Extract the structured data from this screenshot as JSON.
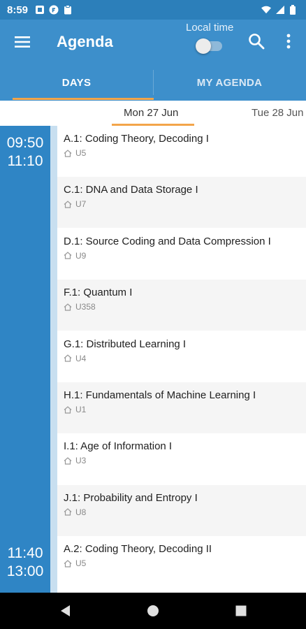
{
  "status_bar": {
    "time": "8:59",
    "left_icons": [
      "notification-square-icon",
      "notification-f-icon",
      "clipboard-icon"
    ],
    "right_icons": [
      "wifi-icon",
      "signal-icon",
      "battery-icon"
    ]
  },
  "app_bar": {
    "title": "Agenda",
    "local_time_label": "Local time",
    "local_time_enabled": false,
    "icons": [
      "menu-icon",
      "search-icon",
      "more-vert-icon"
    ]
  },
  "tabs": [
    {
      "label": "DAYS",
      "selected": true
    },
    {
      "label": "MY AGENDA",
      "selected": false
    }
  ],
  "days": [
    {
      "label": "Mon 27 Jun",
      "selected": true
    },
    {
      "label": "Tue 28 Jun",
      "selected": false
    }
  ],
  "time_slots": [
    {
      "start": "09:50",
      "end": "11:10"
    },
    {
      "start": "11:40",
      "end": "13:00"
    }
  ],
  "sessions": [
    {
      "title": "A.1: Coding Theory, Decoding I",
      "room": "U5"
    },
    {
      "title": "C.1: DNA and Data Storage I",
      "room": "U7"
    },
    {
      "title": "D.1: Source Coding and Data Compression I",
      "room": "U9"
    },
    {
      "title": "F.1: Quantum I",
      "room": "U358"
    },
    {
      "title": "G.1: Distributed Learning I",
      "room": "U4"
    },
    {
      "title": "H.1: Fundamentals of Machine Learning I",
      "room": "U1"
    },
    {
      "title": "I.1: Age of Information I",
      "room": "U3"
    },
    {
      "title": "J.1: Probability and Entropy I",
      "room": "U8"
    },
    {
      "title": "A.2: Coding Theory, Decoding II",
      "room": "U5"
    }
  ],
  "colors": {
    "status_bar": "#2c7fba",
    "app_bar": "#3d8fcb",
    "accent": "#f3a54a",
    "time_column": "#2f85c5"
  }
}
